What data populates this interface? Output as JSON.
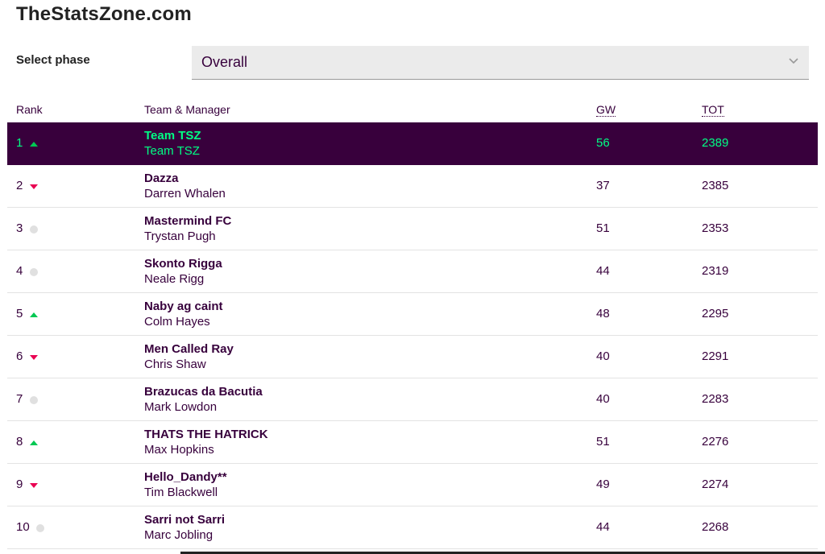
{
  "site": {
    "title": "TheStatsZone.com"
  },
  "phase": {
    "label": "Select phase",
    "selected": "Overall"
  },
  "table": {
    "headers": {
      "rank": "Rank",
      "team": "Team & Manager",
      "gw": "GW",
      "tot": "TOT"
    },
    "rows": [
      {
        "rank": "1",
        "movement": "up",
        "team": "Team TSZ",
        "manager": "Team TSZ",
        "gw": "56",
        "tot": "2389",
        "highlight": true
      },
      {
        "rank": "2",
        "movement": "down",
        "team": "Dazza",
        "manager": "Darren Whalen",
        "gw": "37",
        "tot": "2385"
      },
      {
        "rank": "3",
        "movement": "same",
        "team": "Mastermind FC",
        "manager": "Trystan Pugh",
        "gw": "51",
        "tot": "2353"
      },
      {
        "rank": "4",
        "movement": "same",
        "team": "Skonto Rigga",
        "manager": "Neale Rigg",
        "gw": "44",
        "tot": "2319"
      },
      {
        "rank": "5",
        "movement": "up",
        "team": "Naby ag caint",
        "manager": "Colm Hayes",
        "gw": "48",
        "tot": "2295"
      },
      {
        "rank": "6",
        "movement": "down",
        "team": "Men Called Ray",
        "manager": "Chris Shaw",
        "gw": "40",
        "tot": "2291"
      },
      {
        "rank": "7",
        "movement": "same",
        "team": "Brazucas da Bacutia",
        "manager": "Mark Lowdon",
        "gw": "40",
        "tot": "2283"
      },
      {
        "rank": "8",
        "movement": "up",
        "team": "THATS THE HATRICK",
        "manager": "Max Hopkins",
        "gw": "51",
        "tot": "2276"
      },
      {
        "rank": "9",
        "movement": "down",
        "team": "Hello_Dandy**",
        "manager": "Tim Blackwell",
        "gw": "49",
        "tot": "2274"
      },
      {
        "rank": "10",
        "movement": "same",
        "team": "Sarri not Sarri",
        "manager": "Marc Jobling",
        "gw": "44",
        "tot": "2268"
      }
    ]
  },
  "colors": {
    "primary": "#37003c",
    "highlight_bg": "#38003c",
    "highlight_text": "#00ff85",
    "up": "#00c853",
    "down": "#e90052",
    "same": "#e0e0e0"
  },
  "icons": {
    "up": "triangle-up-icon",
    "down": "triangle-down-icon",
    "same": "circle-icon",
    "select": "chevron-down-icon"
  }
}
